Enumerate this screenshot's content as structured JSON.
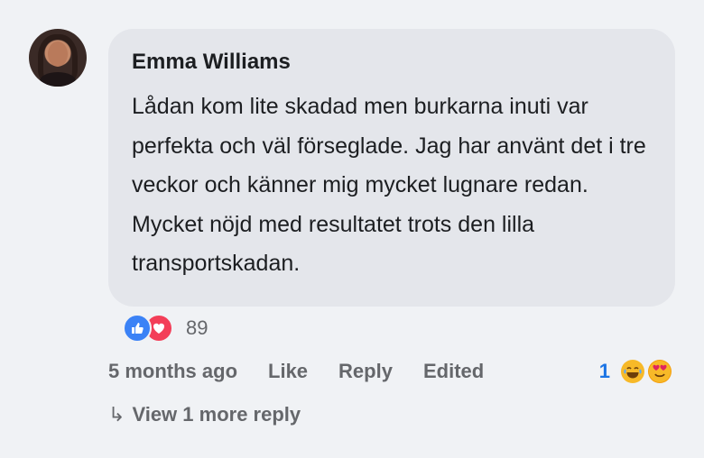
{
  "comment": {
    "author": "Emma Williams",
    "text": "Lådan kom lite skadad men burkarna inuti var perfekta och väl förseglade. Jag har använt det i tre veckor och känner mig mycket lugnare redan. Mycket nöjd med resultatet trots den lilla transportskadan.",
    "reactions": {
      "count": "89",
      "icons": [
        "like-icon",
        "love-icon"
      ],
      "colors": {
        "like": "#3b82f6",
        "love": "#f33e58"
      }
    },
    "actions": {
      "time": "5 months ago",
      "like": "Like",
      "reply": "Reply",
      "edited": "Edited"
    },
    "mini_reactions": {
      "count": "1",
      "icons": [
        "laughing-emoji-icon",
        "heart-eyes-emoji-icon"
      ]
    },
    "view_replies": {
      "arrow": "↳",
      "label": "View 1 more reply"
    }
  }
}
